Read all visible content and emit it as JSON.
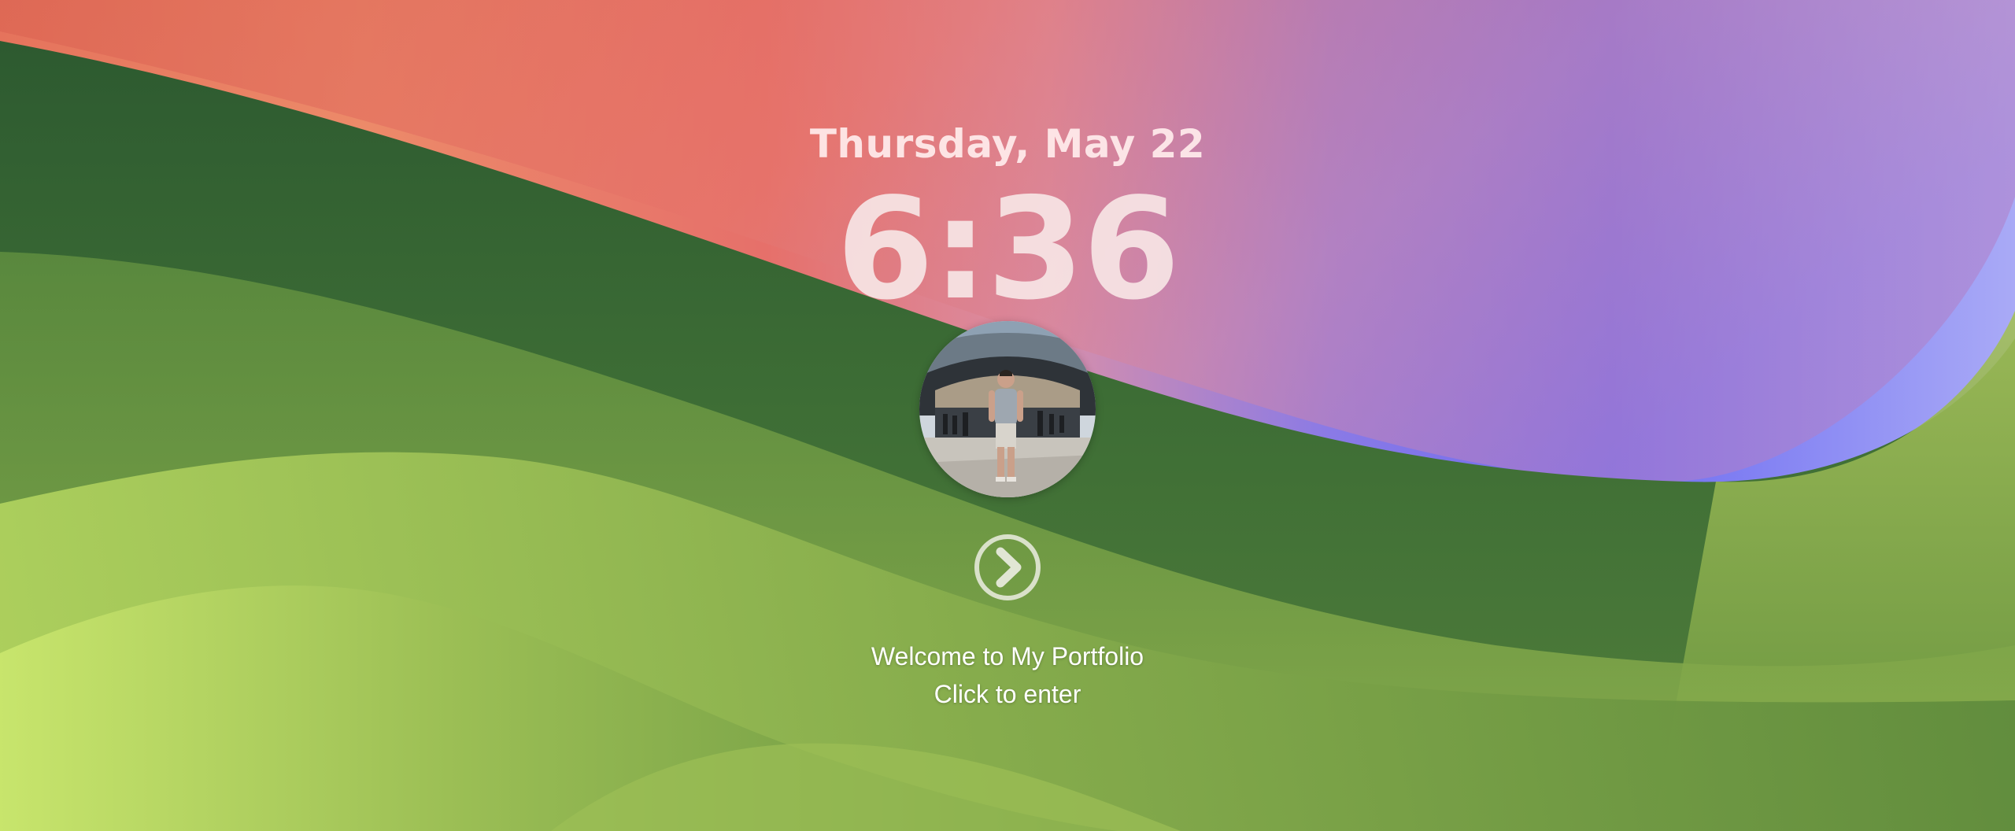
{
  "lock_screen": {
    "date": "Thursday, May 22",
    "time": "6:36",
    "welcome_line": "Welcome to My Portfolio",
    "enter_hint": "Click to enter"
  },
  "icons": {
    "enter": "chevron-right-circle-icon"
  },
  "colors": {
    "wallpaper_green_dark": "#2f5c31",
    "wallpaper_green_light": "#c4e46a",
    "wallpaper_coral": "#e26a5e",
    "wallpaper_orange": "#ee8a68",
    "wallpaper_pink": "#d98aa8",
    "wallpaper_blue": "#6c69f0",
    "wallpaper_lavender": "#a6a8f6",
    "text_light": "#f4e6e6"
  }
}
